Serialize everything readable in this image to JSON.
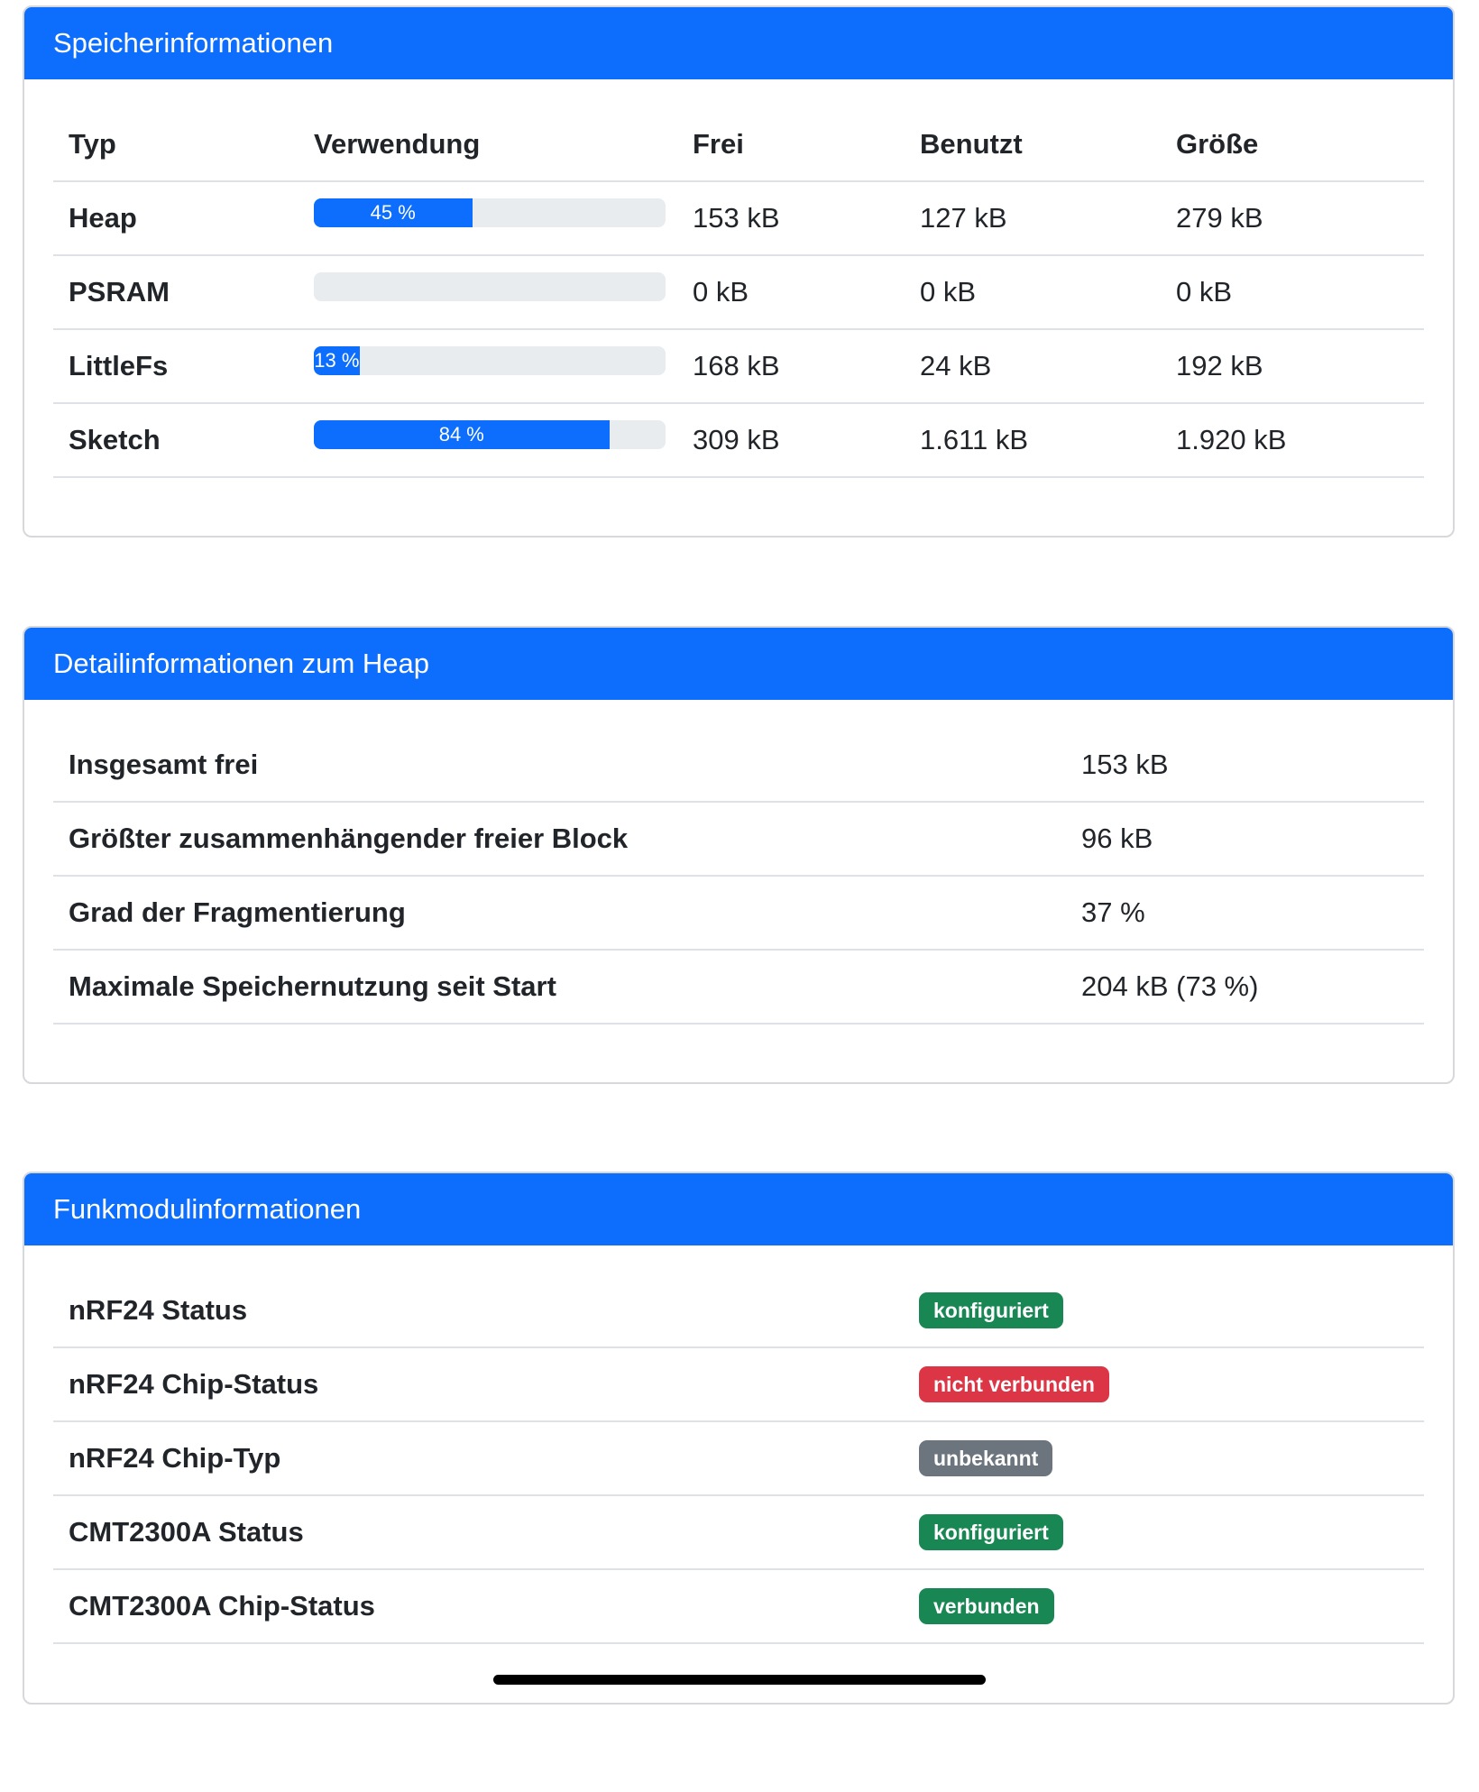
{
  "memory": {
    "title": "Speicherinformationen",
    "headers": {
      "type": "Typ",
      "usage": "Verwendung",
      "free": "Frei",
      "used": "Benutzt",
      "size": "Größe"
    },
    "rows": [
      {
        "type": "Heap",
        "usage_percent": 45,
        "usage_label": "45 %",
        "free": "153 kB",
        "used": "127 kB",
        "size": "279 kB"
      },
      {
        "type": "PSRAM",
        "usage_percent": 0,
        "usage_label": "",
        "free": "0 kB",
        "used": "0 kB",
        "size": "0 kB"
      },
      {
        "type": "LittleFs",
        "usage_percent": 13,
        "usage_label": "13 %",
        "free": "168 kB",
        "used": "24 kB",
        "size": "192 kB"
      },
      {
        "type": "Sketch",
        "usage_percent": 84,
        "usage_label": "84 %",
        "free": "309 kB",
        "used": "1.611 kB",
        "size": "1.920 kB"
      }
    ]
  },
  "heap": {
    "title": "Detailinformationen zum Heap",
    "rows": [
      {
        "label": "Insgesamt frei",
        "value": "153 kB"
      },
      {
        "label": "Größter zusammenhängender freier Block",
        "value": "96 kB"
      },
      {
        "label": "Grad der Fragmentierung",
        "value": "37 %"
      },
      {
        "label": "Maximale Speichernutzung seit Start",
        "value": "204 kB (73 %)"
      }
    ]
  },
  "radio": {
    "title": "Funkmodulinformationen",
    "rows": [
      {
        "label": "nRF24 Status",
        "badge": "konfiguriert",
        "badge_color": "#198754"
      },
      {
        "label": "nRF24 Chip-Status",
        "badge": "nicht verbunden",
        "badge_color": "#dc3545"
      },
      {
        "label": "nRF24 Chip-Typ",
        "badge": "unbekannt",
        "badge_color": "#6c757d"
      },
      {
        "label": "CMT2300A Status",
        "badge": "konfiguriert",
        "badge_color": "#198754"
      },
      {
        "label": "CMT2300A Chip-Status",
        "badge": "verbunden",
        "badge_color": "#198754"
      }
    ]
  },
  "colors": {
    "primary": "#0d6efd",
    "success": "#198754",
    "danger": "#dc3545",
    "secondary": "#6c757d"
  }
}
